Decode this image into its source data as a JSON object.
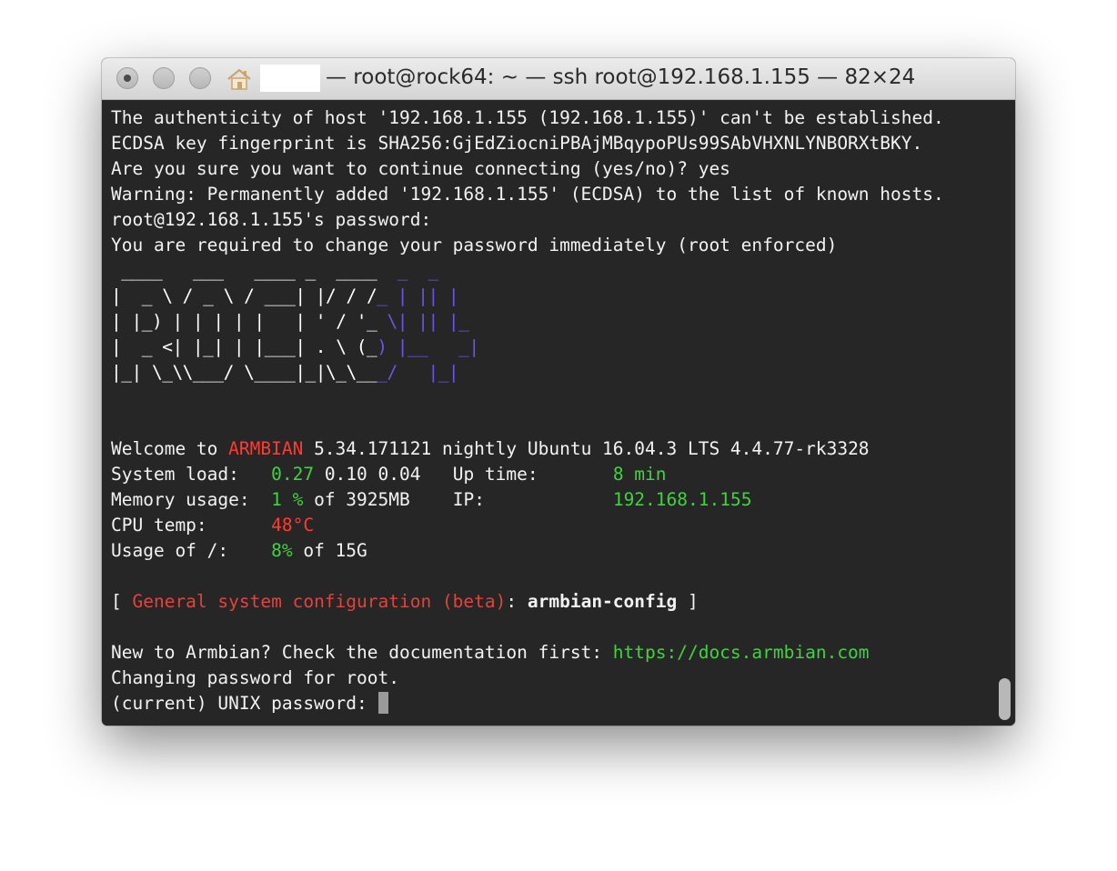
{
  "window": {
    "title": "— root@rock64: ~ — ssh root@192.168.1.155 — 82×24"
  },
  "icons": {
    "close": "close-traffic-light",
    "minimize": "minimize-traffic-light",
    "zoom": "zoom-traffic-light",
    "home": "home-icon"
  },
  "colors": {
    "terminal_bg": "#262626",
    "text": "#f2f2f2",
    "green": "#3ed43e",
    "red": "#ff3b30",
    "logo_blue": "#6a55e6"
  },
  "terminal": {
    "lines": [
      "The authenticity of host '192.168.1.155 (192.168.1.155)' can't be established.",
      "ECDSA key fingerprint is SHA256:GjEdZiocniPBAjMBqypoPUs99SAbVHXNLYNBORXtBKY.",
      "Are you sure you want to continue connecting (yes/no)? yes",
      "Warning: Permanently added '192.168.1.155' (ECDSA) to the list of known hosts.",
      "root@192.168.1.155's password:",
      "You are required to change your password immediately (root enforced)"
    ],
    "logo_lines": [
      " ____   ___   ____ _  ____  _  _",
      "|  _ \\ / _ \\ / ___| |/ / /_ | || |",
      "| |_) | | | | |   | ' / '_ \\| || |_",
      "|  _ <| |_| | |___| . \\ (_) |__   _|",
      "|_| \\_\\\\___/ \\____|_|\\_\\___/   |_|"
    ],
    "welcome": {
      "prefix": "Welcome to ",
      "brand": "ARMBIAN",
      "rest": " 5.34.171121 nightly Ubuntu 16.04.3 LTS 4.4.77-rk3328"
    },
    "stats": {
      "system_load_label": "System load:   ",
      "load1": "0.27",
      "load_rest": " 0.10 0.04   ",
      "uptime_label": "Up time:       ",
      "uptime_value": "8 min",
      "memory_label": "Memory usage:  ",
      "memory_pct": "1 %",
      "memory_rest": " of 3925MB    ",
      "ip_label": "IP:            ",
      "ip_value": "192.168.1.155",
      "cpu_label": "CPU temp:      ",
      "cpu_value": "48°C",
      "usage_label": "Usage of /:    ",
      "usage_pct": "8%",
      "usage_rest": " of 15G"
    },
    "config": {
      "open": "[ ",
      "label": "General system configuration (beta)",
      "colon": ": ",
      "command": "armbian-config",
      "close": " ]"
    },
    "docs": {
      "text": "New to Armbian? Check the documentation first: ",
      "link": "https://docs.armbian.com"
    },
    "changing": "Changing password for root.",
    "prompt": "(current) UNIX password: "
  }
}
